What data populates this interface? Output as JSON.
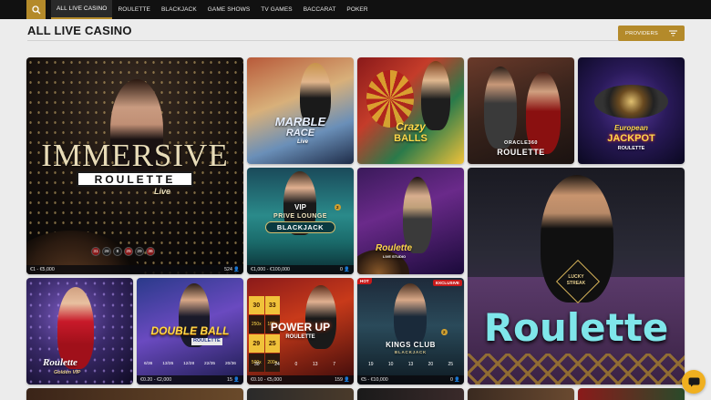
{
  "nav": {
    "items": [
      "ALL LIVE CASINO",
      "ROULETTE",
      "BLACKJACK",
      "GAME SHOWS",
      "TV GAMES",
      "BACCARAT",
      "POKER"
    ]
  },
  "page": {
    "title": "ALL LIVE CASINO",
    "providers_label": "PROVIDERS"
  },
  "colors": {
    "accent": "#b48a2a",
    "topbar": "#111111",
    "background": "#ececec"
  },
  "games": {
    "immersive": {
      "brand_line1": "IMMERSIVE",
      "brand_line2": "ROULETTE",
      "brand_line3": "Live",
      "numbers": [
        "31",
        "28",
        "8",
        "25",
        "29",
        "36"
      ],
      "limits": "€1 - €5,000",
      "players": "524"
    },
    "marble": {
      "brand_line1": "MARBLE",
      "brand_line2": "RACE",
      "brand_line3": "Live"
    },
    "crazy": {
      "brand_line1": "Crazy",
      "brand_line2": "BALLS"
    },
    "oracle": {
      "brand_line1": "ORACLE360",
      "brand_line2": "ROULETTE"
    },
    "jackpot": {
      "brand_line1": "European",
      "brand_line2": "JACKPOT",
      "brand_line3": "ROULETTE"
    },
    "vip": {
      "brand_line1": "VIP",
      "brand_line2": "PRIVE LOUNGE",
      "brand_line3": "BLACKJACK",
      "badge": "2",
      "limits": "€1,000 - €100,000",
      "players": "0"
    },
    "roulette_live": {
      "brand_line1": "Roulette",
      "brand_line2": "LIVE STUDIO"
    },
    "lucky": {
      "badge_line1": "LUCKY",
      "badge_line2": "STREAK",
      "brand": "Roulette"
    },
    "goldvip": {
      "brand_line1": "Roulette",
      "brand_line2": "Golden VIP"
    },
    "double": {
      "brand_line1": "DOUBLE BALL",
      "brand_line2": "ROULETTE",
      "results": [
        "6/36",
        "13/35",
        "12/28",
        "22/35",
        "20/36"
      ],
      "limits": "€0.20 - €2,000",
      "players": "15"
    },
    "powerup": {
      "brand_line1": "POWER UP",
      "brand_line2": "ROULETTE",
      "side_numbers": [
        "30",
        "33",
        "29",
        "25"
      ],
      "multipliers": [
        "250x",
        "100x",
        "500x",
        "200x"
      ],
      "results": [
        "30",
        "24",
        "0",
        "13",
        "7"
      ],
      "limits": "€0.10 - €5,000",
      "players": "159"
    },
    "kings": {
      "hot": "HOT",
      "exclusive": "EXCLUSIVE",
      "badge": "2",
      "brand_line1": "KINGS CLUB",
      "brand_line2": "BLACKJACK",
      "results": [
        "19",
        "10",
        "13",
        "20",
        "25"
      ],
      "limits": "€5 - €10,000",
      "players": "0"
    }
  }
}
